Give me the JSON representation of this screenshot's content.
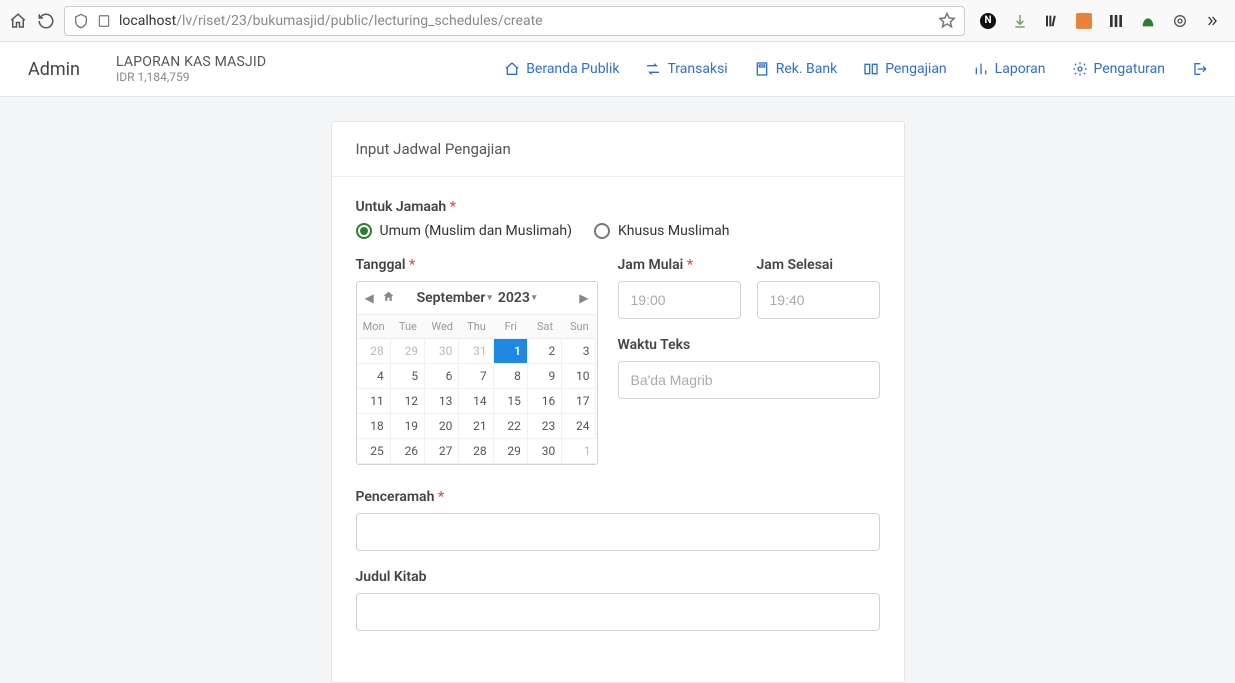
{
  "browser": {
    "url_host": "localhost",
    "url_path": "/lv/riset/23/bukumasjid/public/lecturing_schedules/create"
  },
  "header": {
    "admin": "Admin",
    "brand_title": "LAPORAN KAS MASJID",
    "brand_sub": "IDR 1,184,759",
    "nav": {
      "beranda": "Beranda Publik",
      "transaksi": "Transaksi",
      "rekbank": "Rek. Bank",
      "pengajian": "Pengajian",
      "laporan": "Laporan",
      "pengaturan": "Pengaturan"
    }
  },
  "card": {
    "title": "Input Jadwal Pengajian",
    "jamaah_label": "Untuk Jamaah",
    "jamaah_opt1": "Umum (Muslim dan Muslimah)",
    "jamaah_opt2": "Khusus Muslimah",
    "tanggal_label": "Tanggal",
    "jam_mulai_label": "Jam Mulai",
    "jam_mulai_ph": "19:00",
    "jam_selesai_label": "Jam Selesai",
    "jam_selesai_ph": "19:40",
    "waktu_teks_label": "Waktu Teks",
    "waktu_teks_ph": "Ba'da Magrib",
    "penceramah_label": "Penceramah",
    "judul_kitab_label": "Judul Kitab"
  },
  "calendar": {
    "month": "September",
    "year": "2023",
    "dow": [
      "Mon",
      "Tue",
      "Wed",
      "Thu",
      "Fri",
      "Sat",
      "Sun"
    ],
    "rows": [
      [
        {
          "d": "28",
          "m": true
        },
        {
          "d": "29",
          "m": true
        },
        {
          "d": "30",
          "m": true
        },
        {
          "d": "31",
          "m": true
        },
        {
          "d": "1",
          "sel": true
        },
        {
          "d": "2"
        },
        {
          "d": "3"
        }
      ],
      [
        {
          "d": "4"
        },
        {
          "d": "5"
        },
        {
          "d": "6"
        },
        {
          "d": "7"
        },
        {
          "d": "8"
        },
        {
          "d": "9"
        },
        {
          "d": "10"
        }
      ],
      [
        {
          "d": "11"
        },
        {
          "d": "12"
        },
        {
          "d": "13"
        },
        {
          "d": "14"
        },
        {
          "d": "15"
        },
        {
          "d": "16"
        },
        {
          "d": "17"
        }
      ],
      [
        {
          "d": "18"
        },
        {
          "d": "19"
        },
        {
          "d": "20"
        },
        {
          "d": "21"
        },
        {
          "d": "22"
        },
        {
          "d": "23"
        },
        {
          "d": "24"
        }
      ],
      [
        {
          "d": "25"
        },
        {
          "d": "26"
        },
        {
          "d": "27"
        },
        {
          "d": "28"
        },
        {
          "d": "29"
        },
        {
          "d": "30"
        },
        {
          "d": "1",
          "m": true
        }
      ]
    ]
  }
}
